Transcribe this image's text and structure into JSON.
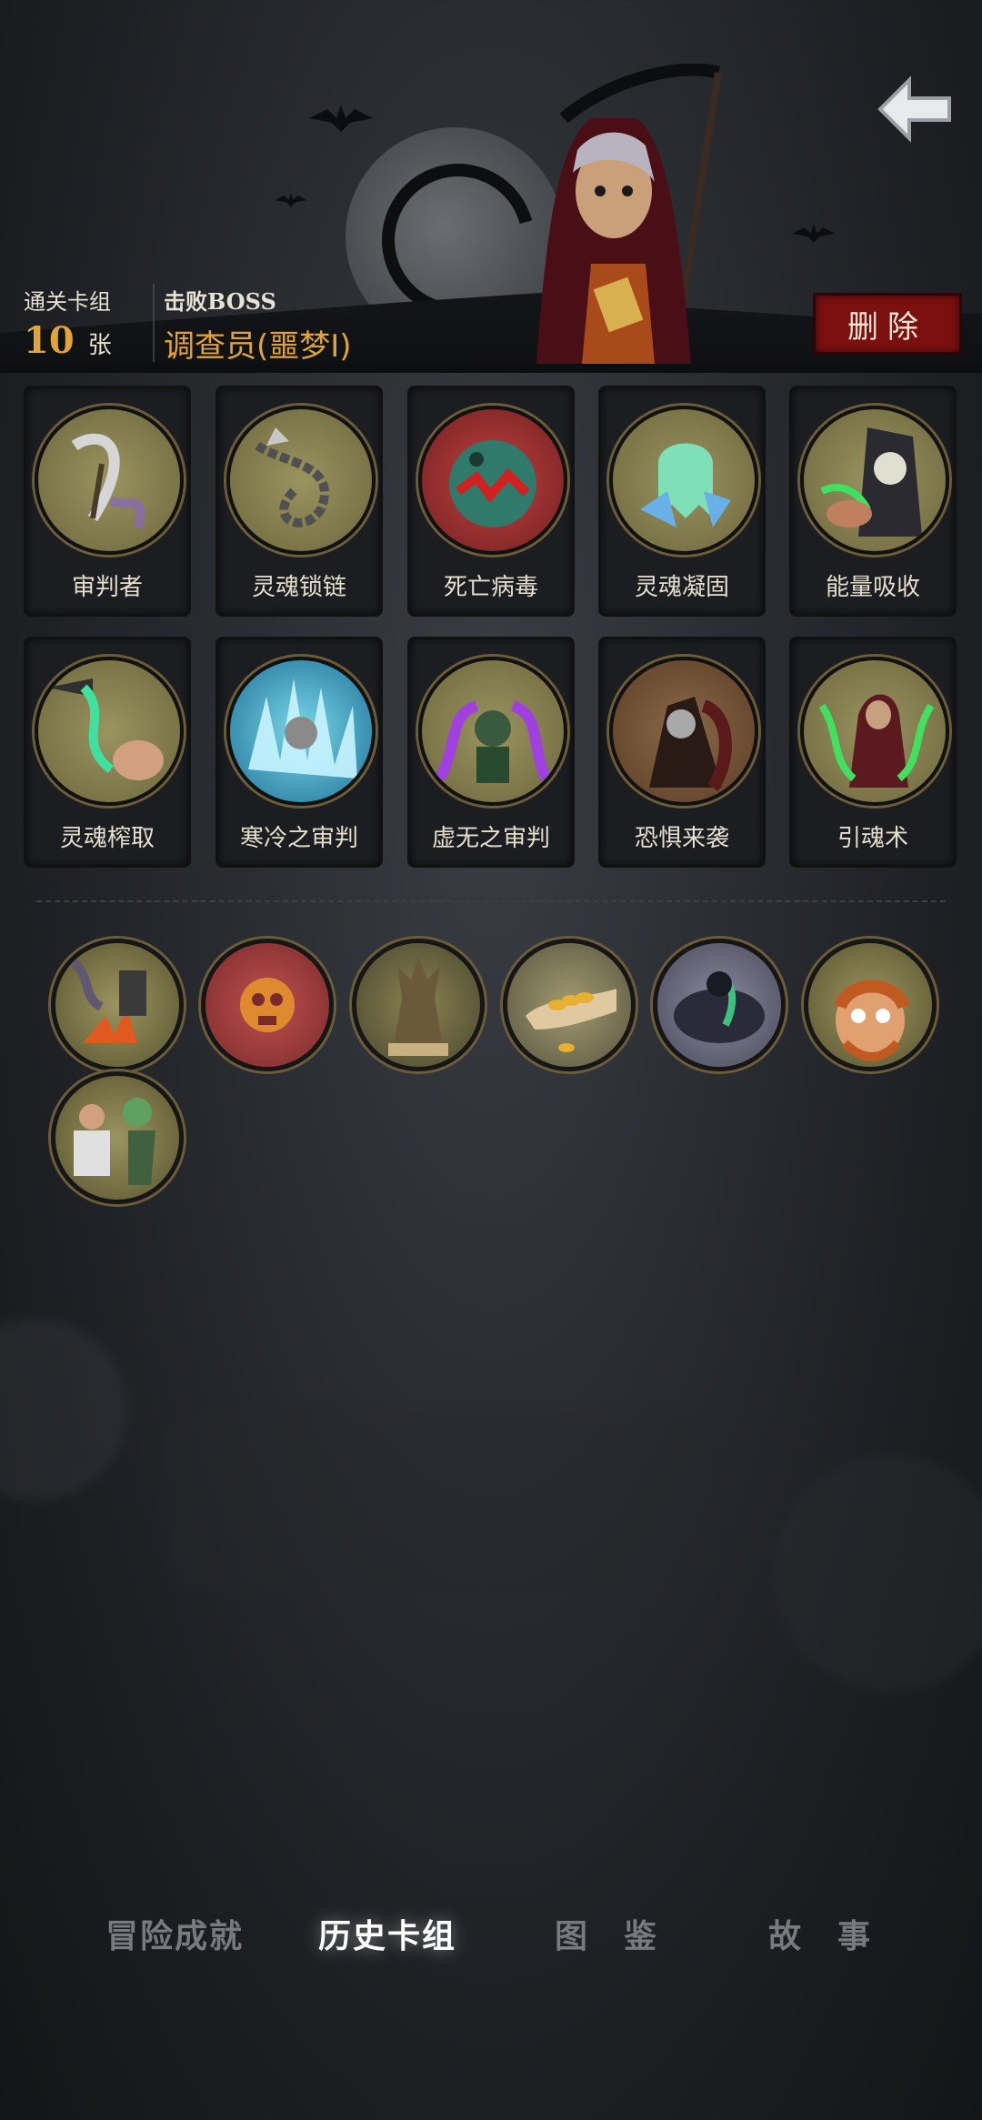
{
  "header": {
    "cleared_deck_label": "通关卡组",
    "cleared_deck_count": "10",
    "cleared_deck_unit": "张",
    "boss_label": "击败BOSS",
    "boss_name": "调查员(噩梦Ⅰ)",
    "delete_label": "删除",
    "back_icon": "back-arrow-icon"
  },
  "cards": [
    {
      "label": "审判者",
      "icon": "scythe-icon",
      "tint": "#8a8a5a"
    },
    {
      "label": "灵魂锁链",
      "icon": "chain-icon",
      "tint": "#8a8a5a"
    },
    {
      "label": "死亡病毒",
      "icon": "virus-icon",
      "tint": "#2f7a6a"
    },
    {
      "label": "灵魂凝固",
      "icon": "ghost-icon",
      "tint": "#7fd6c8"
    },
    {
      "label": "能量吸收",
      "icon": "skeleton-icon",
      "tint": "#8a8a5a"
    },
    {
      "label": "灵魂榨取",
      "icon": "soul-drain-icon",
      "tint": "#8a8a5a"
    },
    {
      "label": "寒冷之审判",
      "icon": "ice-icon",
      "tint": "#6fd0e0"
    },
    {
      "label": "虚无之审判",
      "icon": "void-icon",
      "tint": "#8a5ab0"
    },
    {
      "label": "恐惧来袭",
      "icon": "fear-icon",
      "tint": "#7a5a40"
    },
    {
      "label": "引魂术",
      "icon": "summon-icon",
      "tint": "#8a8a5a"
    }
  ],
  "relics": [
    {
      "icon": "campfire-icon",
      "tint": "#8a8a5a"
    },
    {
      "icon": "skull-coin-icon",
      "tint": "#b04a4a"
    },
    {
      "icon": "statue-icon",
      "tint": "#8a8a5a"
    },
    {
      "icon": "gold-coins-icon",
      "tint": "#8a8a5a"
    },
    {
      "icon": "dark-cloud-icon",
      "tint": "#6a6a7a"
    },
    {
      "icon": "scared-man-icon",
      "tint": "#8a8a5a"
    },
    {
      "icon": "zombie-icon",
      "tint": "#8a8a5a"
    }
  ],
  "nav": [
    {
      "label": "冒险成就",
      "active": false
    },
    {
      "label": "历史卡组",
      "active": true
    },
    {
      "label": "图　鉴",
      "active": false
    },
    {
      "label": "故　事",
      "active": false
    }
  ]
}
